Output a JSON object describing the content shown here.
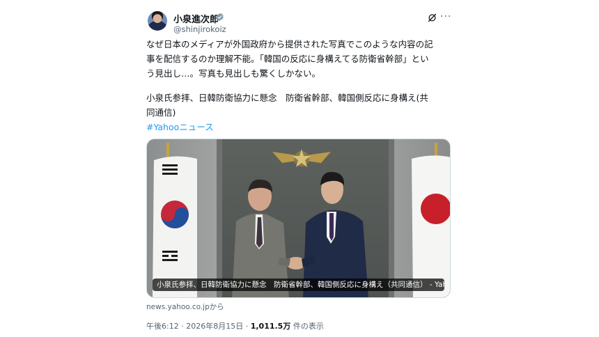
{
  "author": {
    "name": "小泉進次郎",
    "handle": "@shinjirokoiz",
    "verified": true,
    "badge_color": "#829aab"
  },
  "post": {
    "text_lines": [
      "なぜ日本のメディアが外国政府から提供された写真でこのような内容の記",
      "事を配信するのか理解不能。「韓国の反応に身構えてる防衛省幹部」とい",
      "う見出し…。写真も見出しも驚くしかない。"
    ],
    "quote_lines": [
      "小泉氏参拝、日韓防衛協力に懸念　防衛省幹部、韓国側反応に身構え(共",
      "同通信)"
    ],
    "hashtag": "#Yahooニュース"
  },
  "card": {
    "caption": "小泉氏参拝、日韓防衛協力に懸念　防衛省幹部、韓国側反応に身構え（共同通信） - Yah…",
    "source": "news.yahoo.co.jpから"
  },
  "meta": {
    "time": "午後6:12",
    "date": "2026年8月15日",
    "views": "1,011.5万",
    "views_label": "件の表示"
  },
  "icons": {
    "avatar": "avatar",
    "verified": "verified-badge-icon",
    "grok": "grok-icon",
    "more": "more-options-icon"
  },
  "colors": {
    "link": "#1d9bf0",
    "secondary_text": "#536471"
  }
}
